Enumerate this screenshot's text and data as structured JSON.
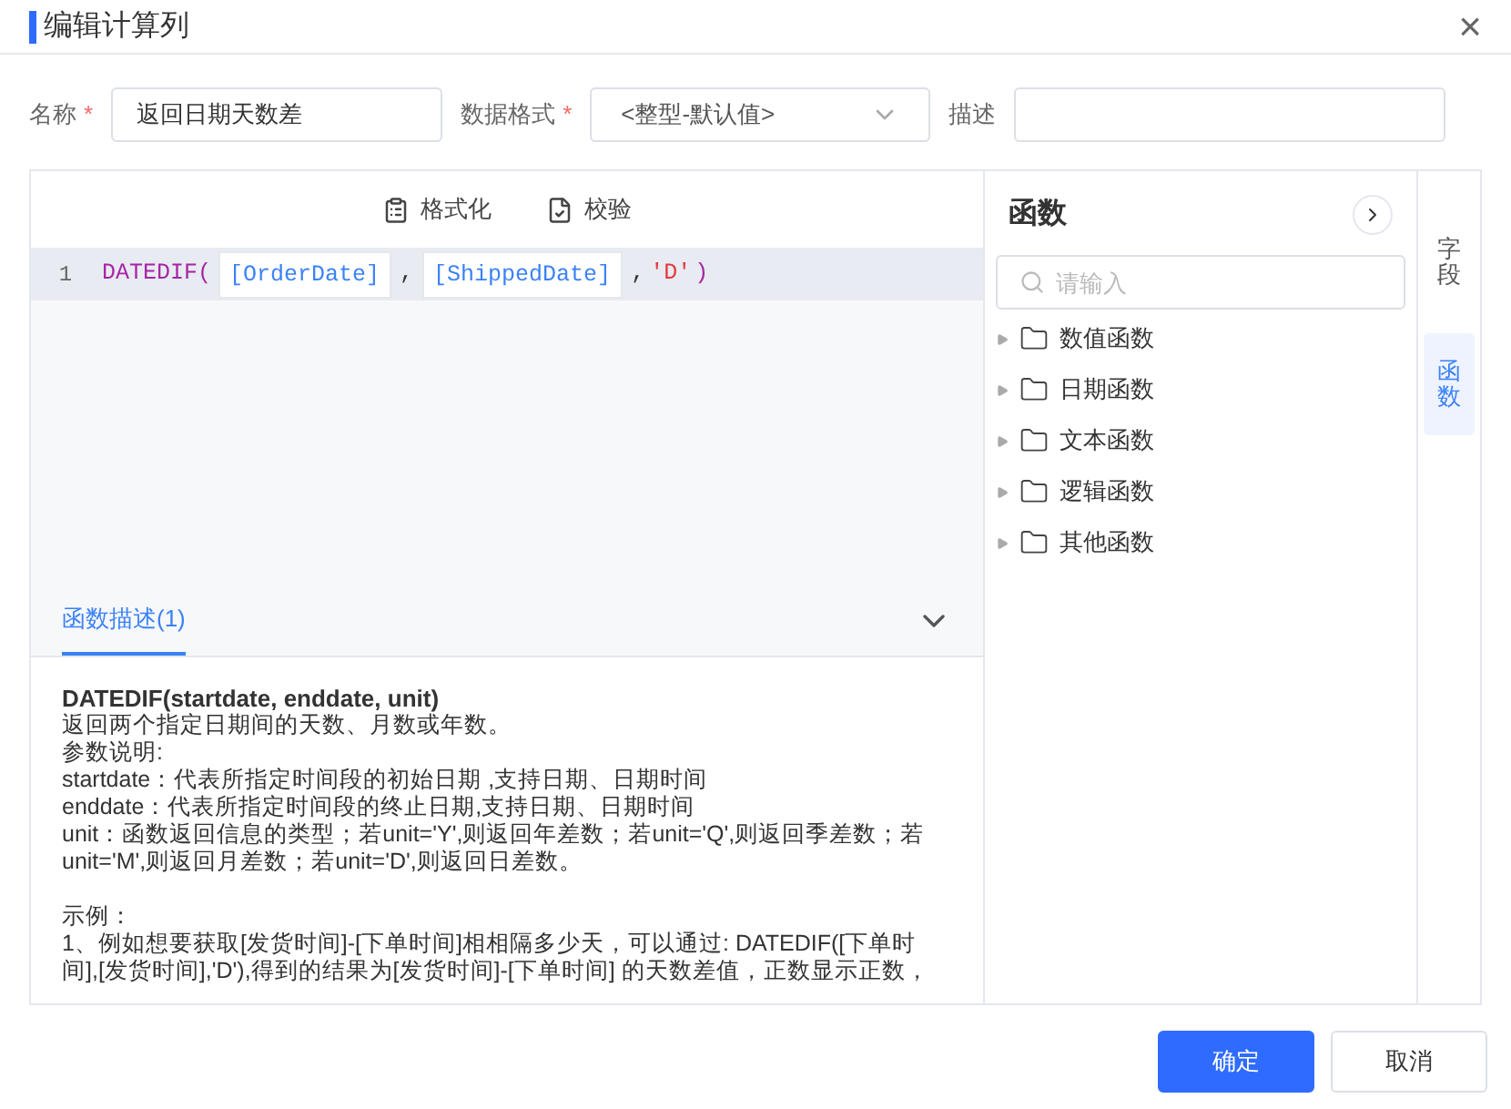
{
  "window": {
    "title": "编辑计算列",
    "close": "×"
  },
  "form": [
    {
      "kind": "input",
      "label": "名称",
      "required_mark": "*",
      "value": "返回日期天数差"
    },
    {
      "kind": "select",
      "label": "数据格式",
      "required_mark": "*",
      "value": "<整型-默认值>"
    },
    {
      "kind": "input",
      "label": "描述"
    }
  ],
  "toolbar": [
    {
      "kind": "format",
      "label": "格式化"
    },
    {
      "kind": "check",
      "label": "校验"
    }
  ],
  "editor": {
    "lines": [
      {
        "number": "1",
        "tokens": [
          {
            "kind": "func",
            "text": "DATEDIF("
          },
          {
            "kind": "field",
            "text": "[OrderDate]"
          },
          {
            "kind": "punct",
            "text": ","
          },
          {
            "kind": "field",
            "text": "[ShippedDate]"
          },
          {
            "kind": "punct",
            "text": ","
          },
          {
            "kind": "string",
            "text": "'D'"
          },
          {
            "kind": "func",
            "text": ")"
          }
        ]
      }
    ]
  },
  "description": {
    "tab": "函数描述(1)",
    "expanded": true,
    "title": "DATEDIF(startdate, enddate, unit)",
    "paragraphs": [
      [
        "返回两个指定日期间的天数、月数或年数。",
        "参数说明:",
        "startdate：代表所指定时间段的初始日期 ,支持日期、日期时间",
        "enddate：代表所指定时间段的终止日期,支持日期、日期时间",
        "unit：函数返回信息的类型；若unit='Y',则返回年差数；若unit='Q',则返回季差数；若unit='M',则返回月差数；若unit='D',则返回日差数。"
      ],
      [
        "示例：",
        "1、例如想要获取[发货时间]-[下单时间]相相隔多少天，可以通过: DATEDIF([下单时间],[发货时间],'D'),得到的结果为[发货时间]-[下单时间] 的天数差值，正数显示正数，"
      ]
    ]
  },
  "functions": {
    "title": "函数",
    "search": {
      "placeholder": "请输入"
    },
    "items": [
      {
        "label": "数值函数",
        "expanded": false
      },
      {
        "label": "日期函数",
        "expanded": false
      },
      {
        "label": "文本函数",
        "expanded": false
      },
      {
        "label": "逻辑函数",
        "expanded": false
      },
      {
        "label": "其他函数",
        "expanded": false
      }
    ]
  },
  "side_tabs": [
    {
      "label": "字段",
      "selected": false
    },
    {
      "label": "函数",
      "selected": true
    }
  ],
  "buttons": [
    {
      "kind": "primary",
      "label": "确定"
    },
    {
      "kind": "secondary",
      "label": "取消"
    }
  ]
}
